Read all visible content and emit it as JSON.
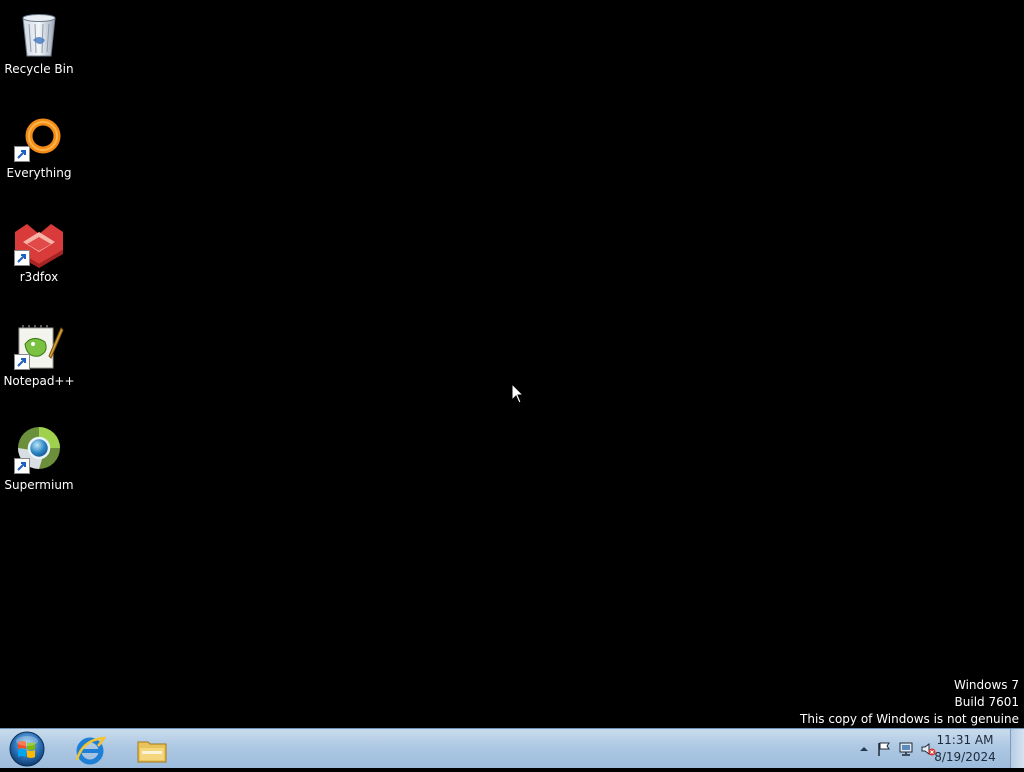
{
  "desktop": {
    "icons": [
      {
        "label": "Recycle Bin",
        "icon": "recycle-bin-icon"
      },
      {
        "label": "Everything",
        "icon": "everything-icon"
      },
      {
        "label": "r3dfox",
        "icon": "r3dfox-icon"
      },
      {
        "label": "Notepad++",
        "icon": "notepadpp-icon"
      },
      {
        "label": "Supermium",
        "icon": "supermium-icon"
      }
    ]
  },
  "watermark": {
    "line1": "Windows 7",
    "line2": "Build 7601",
    "line3": "This copy of Windows is not genuine"
  },
  "taskbar": {
    "start_icon": "windows-orb-icon",
    "pinned": [
      {
        "name": "Internet Explorer",
        "icon": "internet-explorer-icon"
      },
      {
        "name": "Windows Explorer",
        "icon": "file-explorer-icon"
      }
    ],
    "tray": {
      "icons": [
        "show-hidden-icons-arrow",
        "action-center-flag-icon",
        "network-icon",
        "volume-muted-icon"
      ],
      "time": "11:31 AM",
      "date": "8/19/2024"
    }
  },
  "colors": {
    "desktop_bg": "#000000",
    "taskbar_top": "#c9dced",
    "taskbar_bottom": "#9dbcdc",
    "label_text": "#ffffff"
  }
}
